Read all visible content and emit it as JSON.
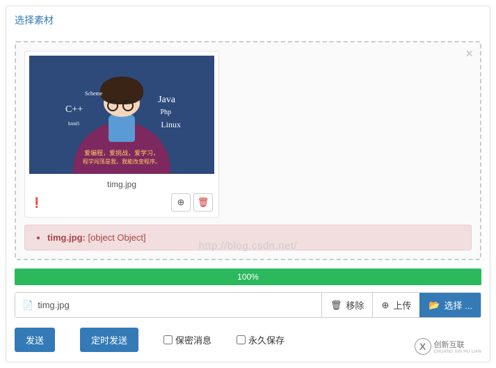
{
  "panel": {
    "title": "选择素材"
  },
  "dropzone": {
    "close_icon": "×",
    "thumbnail": {
      "image_labels": {
        "java": "Java",
        "php": "Php",
        "linux": "Linux",
        "cpp": "C++",
        "scheme": "Scheme",
        "html5": "html5"
      },
      "caption_line1": "爱编程，爱挑战，爱学习，",
      "caption_line2": "程学闯荡是我，我能改变程序。",
      "filename": "timg.jpg",
      "warn_glyph": "❗",
      "action_upload_glyph": "⊕",
      "action_delete_glyph": "🗑"
    },
    "error": {
      "filename": "timg.jpg:",
      "message": " [object Object]"
    }
  },
  "watermark": "http://blog.csdn.net/",
  "progress": {
    "label": "100%",
    "percent": 100
  },
  "file_input": {
    "file_icon": "📄",
    "filename": "timg.jpg",
    "remove_icon": "🗑",
    "remove_label": "移除",
    "upload_icon": "⊕",
    "upload_label": "上传",
    "select_icon": "📂",
    "select_label": "选择 ..."
  },
  "actions": {
    "send": "发送",
    "schedule_send": "定时发送",
    "secret_msg": "保密消息",
    "perm_save": "永久保存"
  },
  "brand": {
    "logo": "X",
    "line1": "创新互联",
    "line2": "CHUANG XIN HU LIAN"
  }
}
